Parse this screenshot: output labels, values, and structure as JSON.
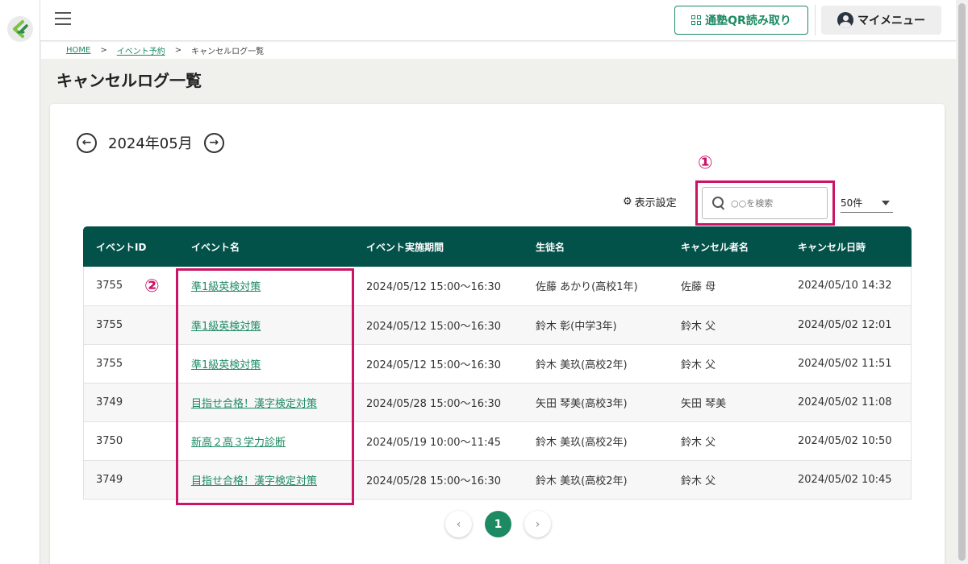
{
  "header": {
    "qr_button_label": "通塾QR読み取り",
    "my_menu_label": "マイメニュー"
  },
  "breadcrumb": {
    "items": [
      "HOME",
      "イベント予約",
      "キャンセルログ一覧"
    ],
    "separator": ">"
  },
  "page": {
    "title": "キャンセルログ一覧"
  },
  "month_nav": {
    "label": "2024年05月",
    "prev_icon": "←",
    "next_icon": "→"
  },
  "annotations": {
    "one": "①",
    "two": "②"
  },
  "toolbar": {
    "settings_label": "表示設定",
    "search_placeholder": "○○を検索",
    "count_value": "50件"
  },
  "table": {
    "columns": [
      "イベントID",
      "イベント名",
      "イベント実施期間",
      "生徒名",
      "キャンセル者名",
      "キャンセル日時"
    ],
    "rows": [
      {
        "id": "3755",
        "name": "準1級英検対策",
        "period": "2024/05/12 15:00～16:30",
        "student": "佐藤 あかり(高校1年)",
        "canceller": "佐藤 母",
        "datetime": "2024/05/10 14:32"
      },
      {
        "id": "3755",
        "name": "準1級英検対策",
        "period": "2024/05/12 15:00～16:30",
        "student": "鈴木 彰(中学3年)",
        "canceller": "鈴木 父",
        "datetime": "2024/05/02 12:01"
      },
      {
        "id": "3755",
        "name": "準1級英検対策",
        "period": "2024/05/12 15:00～16:30",
        "student": "鈴木 美玖(高校2年)",
        "canceller": "鈴木 父",
        "datetime": "2024/05/02 11:51"
      },
      {
        "id": "3749",
        "name": "目指せ合格！漢字検定対策",
        "period": "2024/05/28 15:00～16:30",
        "student": "矢田 琴美(高校3年)",
        "canceller": "矢田 琴美",
        "datetime": "2024/05/02 11:08"
      },
      {
        "id": "3750",
        "name": "新高２高３学力診断",
        "period": "2024/05/19 10:00～11:45",
        "student": "鈴木 美玖(高校2年)",
        "canceller": "鈴木 父",
        "datetime": "2024/05/02 10:50"
      },
      {
        "id": "3749",
        "name": "目指せ合格！漢字検定対策",
        "period": "2024/05/28 15:00～16:30",
        "student": "鈴木 美玖(高校2年)",
        "canceller": "鈴木 父",
        "datetime": "2024/05/02 10:45"
      }
    ]
  },
  "pagination": {
    "prev": "‹",
    "current": "1",
    "next": "›"
  },
  "colors": {
    "accent": "#1e8a63",
    "table_header": "#03524a",
    "annotation": "#cc1466"
  }
}
